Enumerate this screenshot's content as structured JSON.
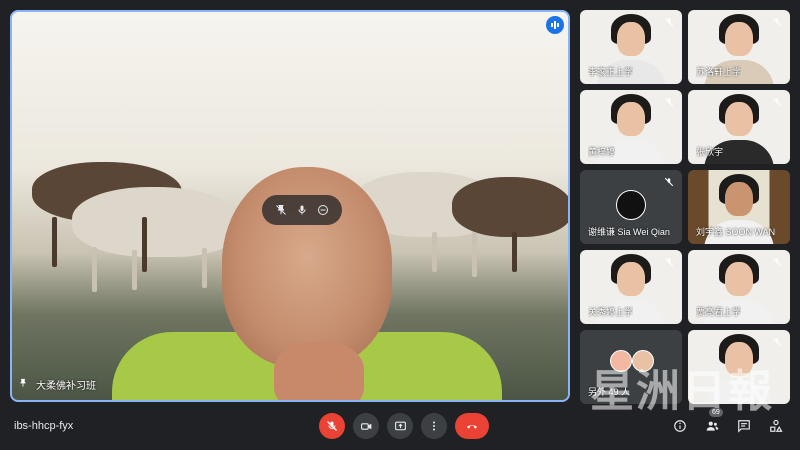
{
  "main_speaker": {
    "name": "大柔佛补习班"
  },
  "tiles": [
    {
      "name": "李家正上学"
    },
    {
      "name": "苏洛轩上学"
    },
    {
      "name": "黄梓婷"
    },
    {
      "name": "张欣宇"
    },
    {
      "name": "谢维谦 Sia Wei Qian"
    },
    {
      "name": "刘宇鑫 SOON WAN"
    },
    {
      "name": "关秀婷上学"
    },
    {
      "name": "贾亮君上学"
    },
    {
      "name": "另外 49 人"
    },
    {
      "name": ""
    }
  ],
  "watermark": "星洲日報",
  "meeting": {
    "code": "ibs-hhcp-fyx",
    "participant_count": "69"
  },
  "colors": {
    "accent": "#8ab4f8",
    "end_call": "#ea4335",
    "background": "#202124"
  }
}
